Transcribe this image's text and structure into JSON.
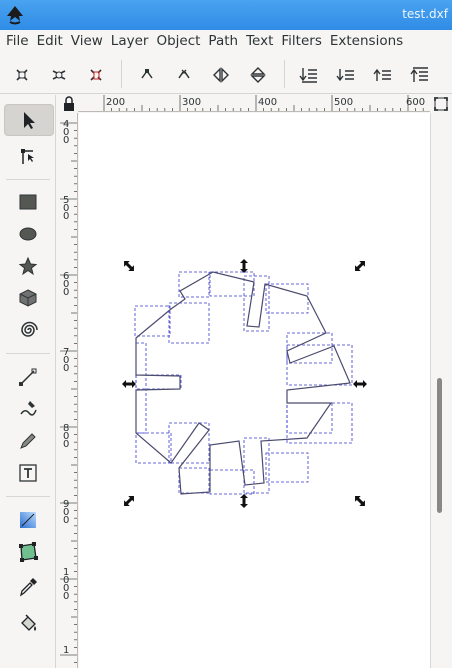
{
  "window": {
    "title": "test.dxf"
  },
  "menu": [
    "File",
    "Edit",
    "View",
    "Layer",
    "Object",
    "Path",
    "Text",
    "Filters",
    "Extensions"
  ],
  "commands": [
    "zoom-selection-icon",
    "zoom-drawing-icon",
    "zoom-page-icon",
    "node-join-icon",
    "node-break-icon",
    "flip-horizontal-icon",
    "flip-vertical-icon",
    "lower-to-bottom-icon",
    "lower-icon",
    "raise-icon",
    "raise-to-top-icon"
  ],
  "tools": [
    "selector-tool",
    "node-tool",
    "rectangle-tool",
    "ellipse-tool",
    "star-tool",
    "3d-box-tool",
    "spiral-tool",
    "pen-tool",
    "calligraphy-tool",
    "pencil-tool",
    "text-tool",
    "gradient-tool",
    "mesh-tool",
    "dropper-tool",
    "paint-bucket-tool"
  ],
  "ruler": {
    "horizontal_labels": [
      "200",
      "300",
      "400",
      "500",
      "600"
    ],
    "vertical_labels": [
      "400",
      "500",
      "600",
      "700",
      "800",
      "900",
      "1000",
      "1"
    ]
  },
  "colors": {
    "titlebar": "#2f8ce6",
    "selection_dash": "#3a3acf",
    "path": "#4b4b6e"
  }
}
